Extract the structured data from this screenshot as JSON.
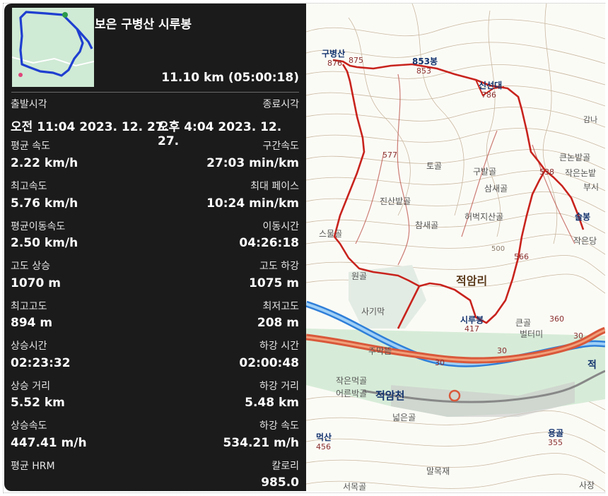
{
  "activity": {
    "title": "보은 구병산 시루봉",
    "summary": "11.10 km (05:00:18)"
  },
  "stats": [
    {
      "left_label": "출발시각",
      "left_value": "오전 11:04 2023. 12. 27.",
      "right_label": "종료시각",
      "right_value": "오후 4:04 2023. 12. 27."
    },
    {
      "left_label": "평균 속도",
      "left_value": "2.22 km/h",
      "right_label": "구간속도",
      "right_value": "27:03 min/km"
    },
    {
      "left_label": "최고속도",
      "left_value": "5.76 km/h",
      "right_label": "최대 페이스",
      "right_value": "10:24 min/km"
    },
    {
      "left_label": "평균이동속도",
      "left_value": "2.50 km/h",
      "right_label": "이동시간",
      "right_value": "04:26:18"
    },
    {
      "left_label": "고도 상승",
      "left_value": "1070 m",
      "right_label": "고도 하강",
      "right_value": "1075 m"
    },
    {
      "left_label": "최고고도",
      "left_value": "894 m",
      "right_label": "최저고도",
      "right_value": "208 m"
    },
    {
      "left_label": "상승시간",
      "left_value": "02:23:32",
      "right_label": "하강 시간",
      "right_value": "02:00:48"
    },
    {
      "left_label": "상승 거리",
      "left_value": "5.52 km",
      "right_label": "하강 거리",
      "right_value": "5.48 km"
    },
    {
      "left_label": "상승속도",
      "left_value": "447.41 m/h",
      "right_label": "하강 속도",
      "right_value": "534.21 m/h"
    },
    {
      "left_label": "평균 HRM",
      "left_value": "",
      "right_label": "칼로리",
      "right_value": "985.0"
    }
  ],
  "map": {
    "labels": {
      "gubyeong": "구병산",
      "peak876": "876",
      "peak875": "875",
      "peak853": "853봉",
      "peak853b": "853",
      "sinseondae": "신선대",
      "peak786": "786",
      "gamna": "감나",
      "peak577": "577",
      "togol": "토골",
      "gubalgol": "구발골",
      "keunnon": "큰논밭골",
      "peak538": "538",
      "jageunnon": "작은논밭",
      "busi": "부시",
      "samsaegol": "삼새골",
      "jinsanbat": "진산밭골",
      "heobeok": "허벅지산골",
      "chamsaegol": "참새골",
      "seulbong": "슬봉",
      "sumulgol": "스물골",
      "peak500": "500",
      "peak566": "566",
      "jageundang": "작은당",
      "wongol": "원골",
      "jeogamri": "적암리",
      "sagimak": "사기막",
      "sirubong": "시루봉",
      "peak417": "417",
      "peak360": "360",
      "road30a": "30",
      "road30b": "30",
      "road30c": "30",
      "keungol": "큰골",
      "beonteomi": "벌터미",
      "jumakddeum": "주막뜸",
      "jeok": "적",
      "jageunmeok": "작은먹골",
      "eoreunbak": "어른박골",
      "jeogamcheon": "적암천",
      "neoleungol": "넓은골",
      "meoksan": "먹산",
      "peak456": "456",
      "yonggol": "용골",
      "peak355": "355",
      "malmokjae": "말목재",
      "seomokgol": "서목골",
      "sajang": "사장"
    }
  }
}
